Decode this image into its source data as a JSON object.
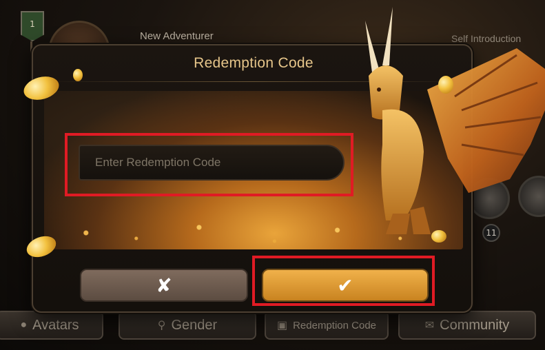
{
  "background": {
    "level": "1",
    "player_name": "New Adventurer",
    "intro_label": "Self Introduction",
    "badge_count": "11"
  },
  "bottom_tabs": [
    {
      "label": "Avatars",
      "icon": "person-icon"
    },
    {
      "label": "Gender",
      "icon": "gender-icon"
    },
    {
      "label": "Redemption Code",
      "icon": "gift-icon"
    },
    {
      "label": "Community",
      "icon": "chat-icon"
    }
  ],
  "dialog": {
    "title": "Redemption Code",
    "input_placeholder": "Enter Redemption Code",
    "input_value": "",
    "cancel_symbol": "✘",
    "confirm_symbol": "✔"
  },
  "colors": {
    "title_gold": "#e6c58a",
    "confirm_button": "#f0b14a",
    "cancel_button": "#7f6b5d",
    "highlight_red": "#e01b24"
  }
}
